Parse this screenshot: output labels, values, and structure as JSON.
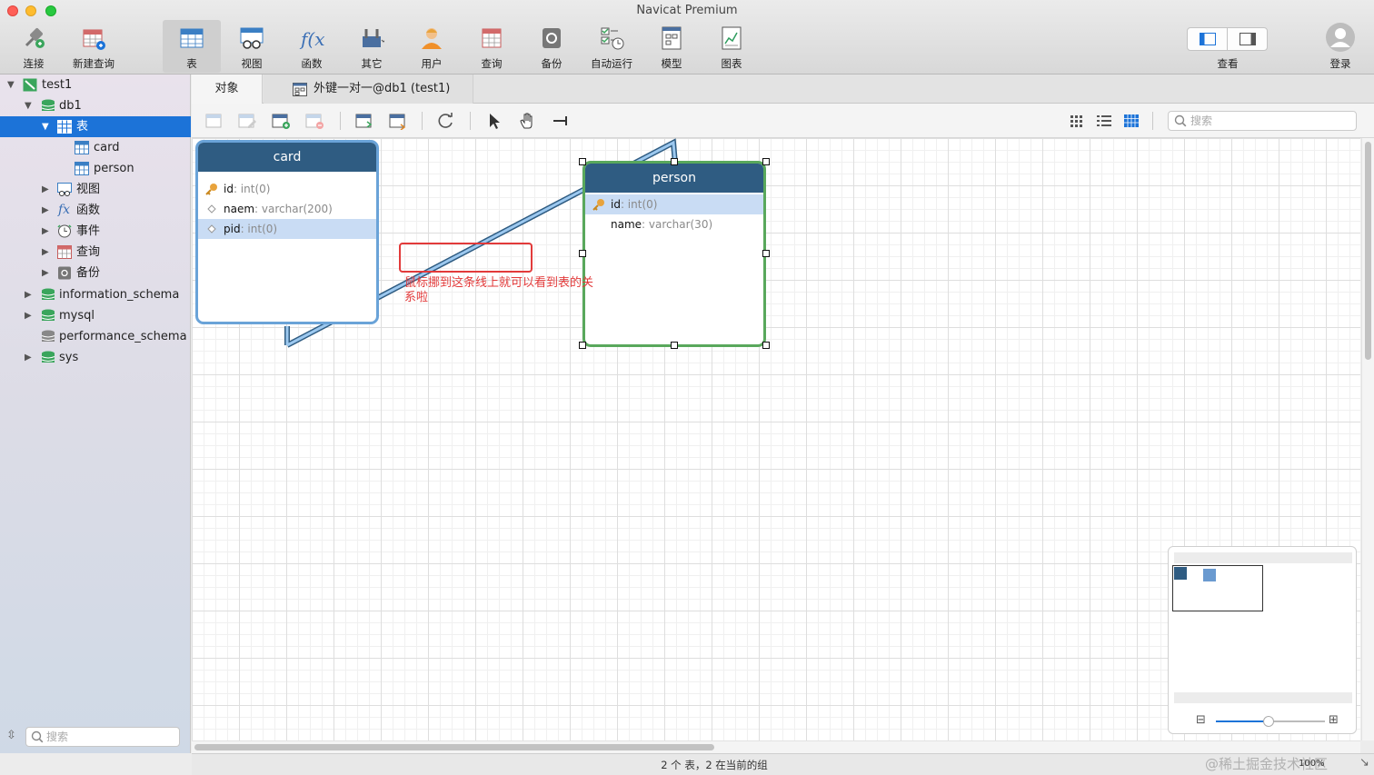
{
  "window": {
    "title": "Navicat Premium"
  },
  "toolbar": {
    "items": [
      {
        "label": "连接",
        "icon": "connection-icon"
      },
      {
        "label": "新建查询",
        "icon": "new-query-icon"
      },
      {
        "label": "表",
        "icon": "table-icon"
      },
      {
        "label": "视图",
        "icon": "view-icon"
      },
      {
        "label": "函数",
        "icon": "function-icon"
      },
      {
        "label": "其它",
        "icon": "tools-icon"
      },
      {
        "label": "用户",
        "icon": "user-icon"
      },
      {
        "label": "查询",
        "icon": "query-icon"
      },
      {
        "label": "备份",
        "icon": "backup-icon"
      },
      {
        "label": "自动运行",
        "icon": "automation-icon"
      },
      {
        "label": "模型",
        "icon": "model-icon"
      },
      {
        "label": "图表",
        "icon": "chart-icon"
      }
    ],
    "view_label": "查看",
    "login_label": "登录"
  },
  "sidebar": {
    "tree": [
      {
        "label": "test1"
      },
      {
        "label": "db1"
      },
      {
        "label": "表"
      },
      {
        "label": "card"
      },
      {
        "label": "person"
      },
      {
        "label": "视图"
      },
      {
        "label": "函数"
      },
      {
        "label": "事件"
      },
      {
        "label": "查询"
      },
      {
        "label": "备份"
      },
      {
        "label": "information_schema"
      },
      {
        "label": "mysql"
      },
      {
        "label": "performance_schema"
      },
      {
        "label": "sys"
      }
    ],
    "search_placeholder": "搜索",
    "fx_glyph": "fx"
  },
  "tabs": [
    {
      "label": "对象"
    },
    {
      "label": "外键一对一@db1 (test1)"
    }
  ],
  "subtoolbar": {
    "search_placeholder": "搜索"
  },
  "diagram": {
    "entities": {
      "card": {
        "name": "card",
        "fields": [
          {
            "name": "id",
            "type": ": int(0)"
          },
          {
            "name": "naem",
            "type": ": varchar(200)"
          },
          {
            "name": "pid",
            "type": ": int(0)"
          }
        ]
      },
      "person": {
        "name": "person",
        "fields": [
          {
            "name": "id",
            "type": ": int(0)"
          },
          {
            "name": "name",
            "type": ": varchar(30)"
          }
        ]
      }
    },
    "annotation": "鼠标挪到这条线上就可以看到表的关系啦",
    "colors": {
      "header": "#2f5c82",
      "selected_border": "#59a85c",
      "relation": "#4a90d9",
      "annotation": "#e23a3a"
    }
  },
  "status": {
    "text": "2 个 表，2 在当前的组",
    "zoom": "100%",
    "watermark": "@稀土掘金技术社区"
  }
}
